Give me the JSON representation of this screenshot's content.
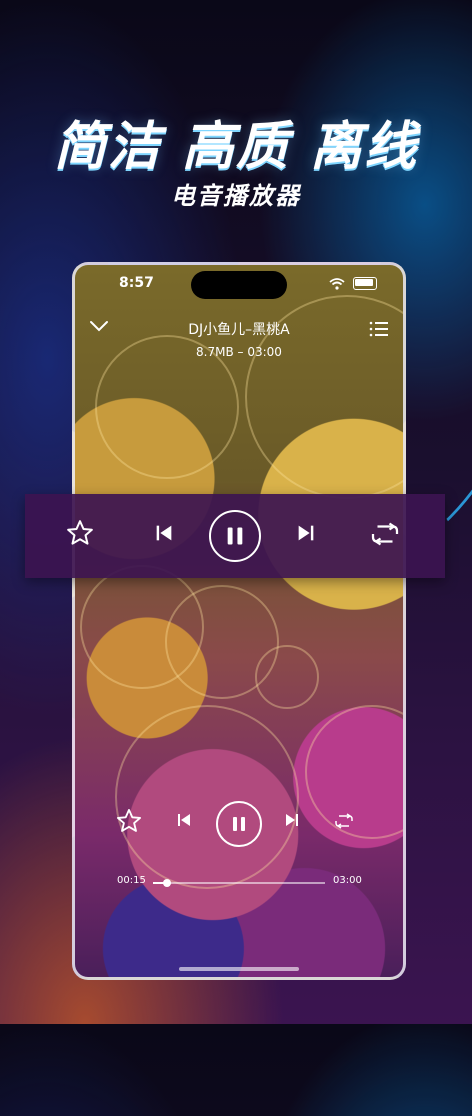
{
  "promo": {
    "headline": "简洁 高质 离线",
    "subtitle": "电音播放器"
  },
  "status": {
    "time": "8:57"
  },
  "player": {
    "title": "DJ小鱼儿–黑桃A",
    "meta": "8.7MB – 03:00",
    "current_time": "00:15",
    "total_time": "03:00",
    "progress": 0.08
  },
  "icons": {
    "collapse": "chevron-down-icon",
    "playlist": "list-icon",
    "favorite": "star-icon",
    "previous": "skip-previous-icon",
    "pause": "pause-icon",
    "next": "skip-next-icon",
    "repeat": "repeat-icon"
  },
  "colors": {
    "overlay_bg": "#3c1450",
    "accent": "#ffffff"
  }
}
